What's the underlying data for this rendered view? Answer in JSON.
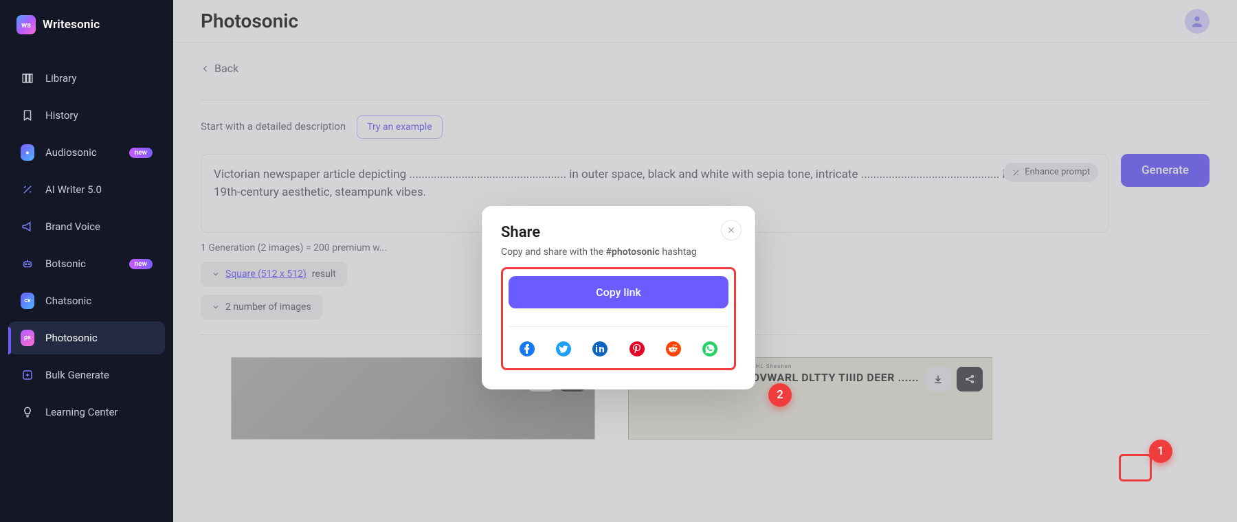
{
  "brand": "Writesonic",
  "brand_abbr": "ws",
  "page_title": "Photosonic",
  "sidebar": {
    "items": [
      {
        "label": "Library",
        "icon": "columns-icon",
        "badge": null
      },
      {
        "label": "History",
        "icon": "bookmark-icon",
        "badge": null
      },
      {
        "label": "Audiosonic",
        "icon": "voice-icon",
        "badge": "new"
      },
      {
        "label": "AI Writer 5.0",
        "icon": "magic-icon",
        "badge": null
      },
      {
        "label": "Brand Voice",
        "icon": "megaphone-icon",
        "badge": null
      },
      {
        "label": "Botsonic",
        "icon": "robot-icon",
        "badge": "new"
      },
      {
        "label": "Chatsonic",
        "icon": "cs-badge",
        "badge": null
      },
      {
        "label": "Photosonic",
        "icon": "ps-badge",
        "badge": null
      },
      {
        "label": "Bulk Generate",
        "icon": "plus-square-icon",
        "badge": null
      },
      {
        "label": "Learning Center",
        "icon": "bulb-icon",
        "badge": null
      }
    ]
  },
  "back_label": "Back",
  "description_label": "Start with a detailed description",
  "try_example_label": "Try an example",
  "prompt_text": "Victorian newspaper article depicting ................................................... in outer space, black and white with sepia tone, intricate ............................................. highly detailed, 19th-century aesthetic, steampunk vibes.",
  "enhance_label": "Enhance prompt",
  "generate_label": "Generate",
  "generation_info": "1 Generation (2 images) = 200 premium w...",
  "chip_size_link": "Square (512 x 512)",
  "chip_size_suffix": " result",
  "chip_count": "2 number of images",
  "newspaper_tiny": "Niue abdum · Somate bortue bees · DJHL Sheshen",
  "newspaper_headline": "BOOTIA FENT BOTTA OVWARL DLTTY TIIID DEER ......",
  "modal": {
    "title": "Share",
    "subtitle_prefix": "Copy and share with the ",
    "subtitle_bold": "#photosonic",
    "subtitle_suffix": " hashtag",
    "copy_label": "Copy link",
    "socials": [
      "facebook",
      "twitter",
      "linkedin",
      "pinterest",
      "reddit",
      "whatsapp"
    ]
  },
  "step1": "1",
  "step2": "2"
}
